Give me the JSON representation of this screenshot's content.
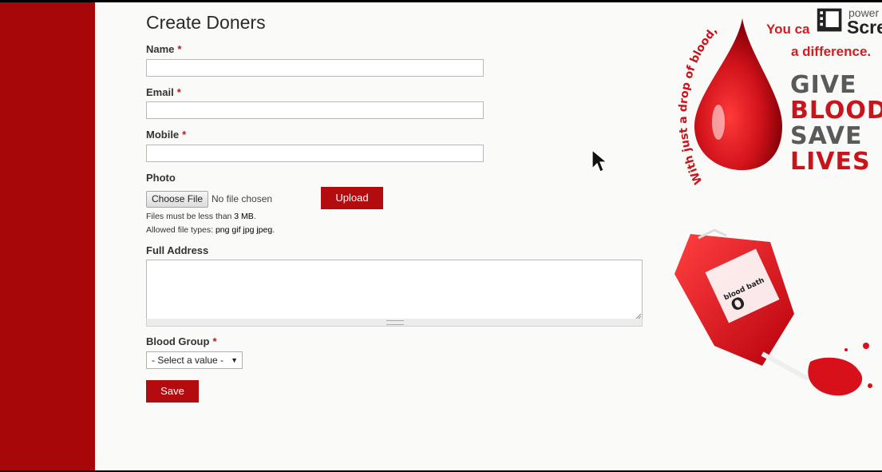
{
  "form": {
    "title": "Create Doners",
    "name_label": "Name",
    "email_label": "Email",
    "mobile_label": "Mobile",
    "required_mark": "*",
    "photo_label": "Photo",
    "choose_file_label": "Choose File",
    "no_file_text": "No file chosen",
    "upload_label": "Upload",
    "hint_size_prefix": "Files must be less than ",
    "hint_size_value": "3 MB",
    "hint_size_suffix": ".",
    "hint_types_prefix": "Allowed file types: ",
    "hint_types_value": "png gif jpg jpeg",
    "hint_types_suffix": ".",
    "address_label": "Full Address",
    "blood_group_label": "Blood Group",
    "blood_group_selected": "- Select a value -",
    "save_label": "Save"
  },
  "promo": {
    "drop_caption": "With just a drop of blood,",
    "line1": "You ca",
    "line2": "a difference.",
    "give": "GIVE",
    "blood": "BLOOD",
    "save": "SAVE",
    "lives": "LIVES",
    "bag_brand": "blood bath",
    "bag_group": "O"
  },
  "watermark": {
    "top": "power",
    "bottom": "Scre"
  },
  "colors": {
    "brand_red": "#a8070a",
    "button_red": "#b30b0e"
  }
}
